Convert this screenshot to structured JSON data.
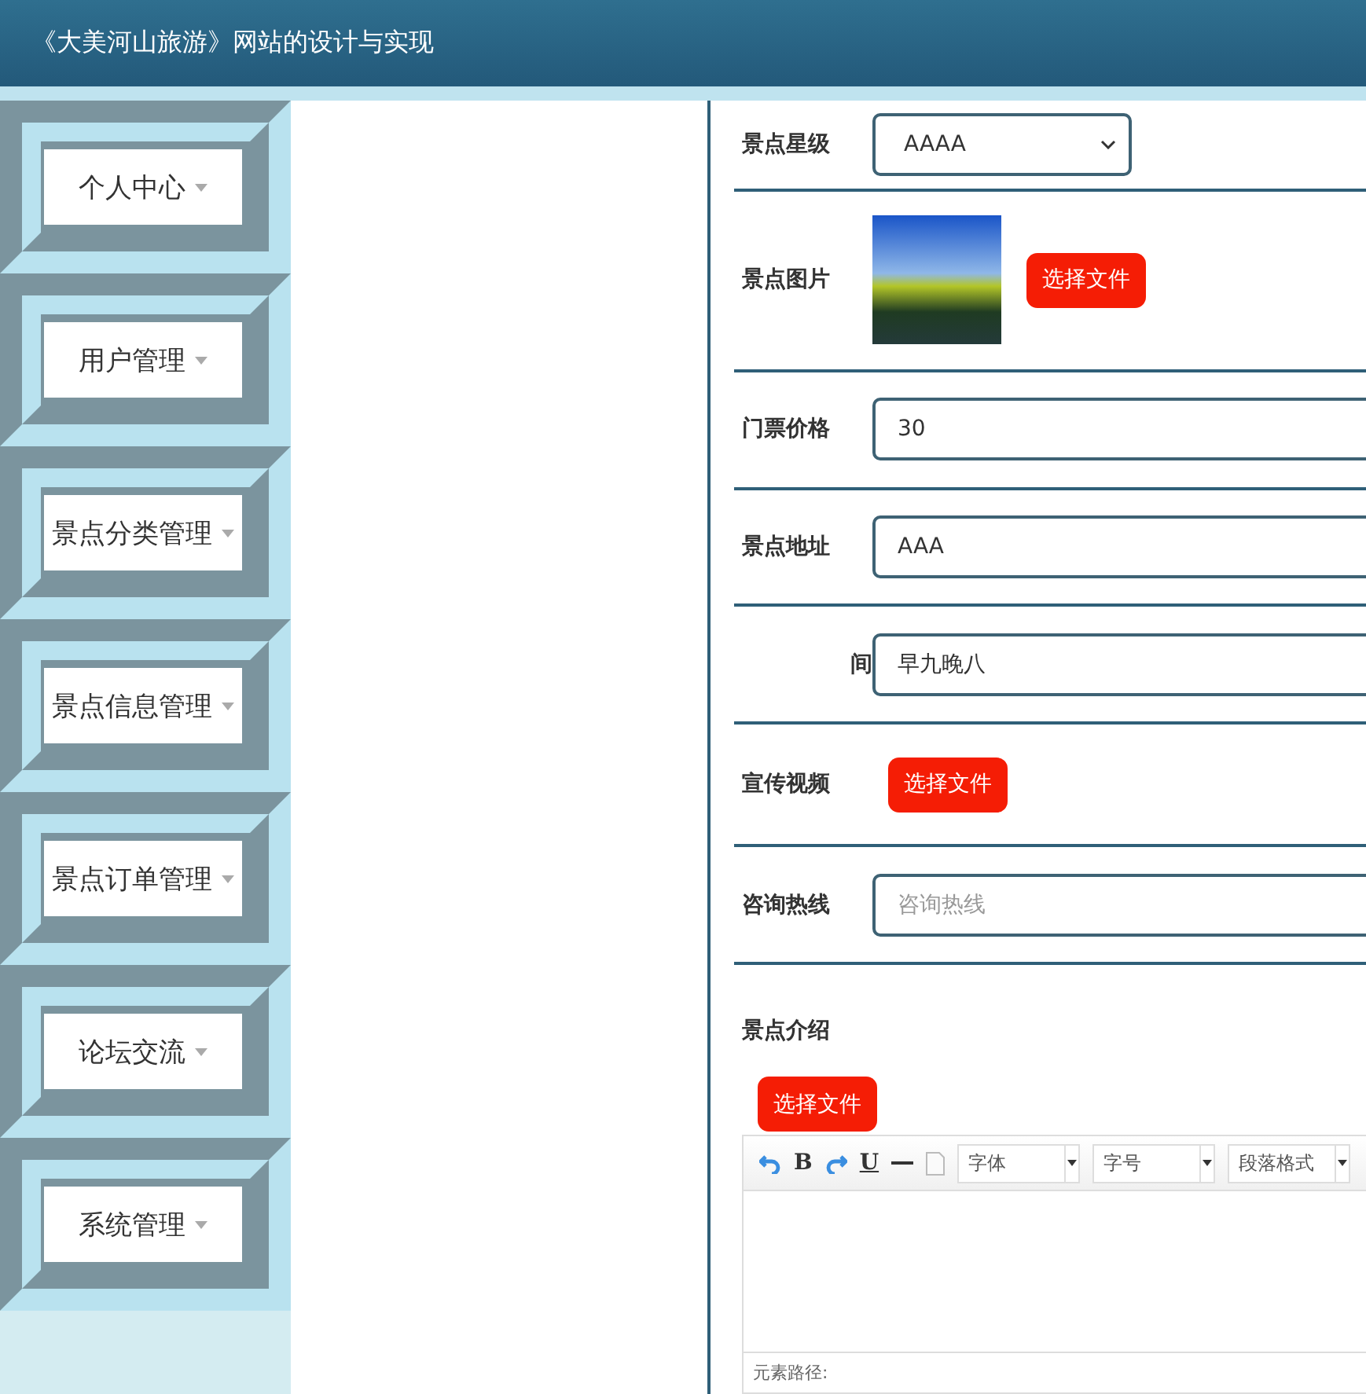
{
  "header": {
    "title": "《大美河山旅游》网站的设计与实现"
  },
  "sidebar": {
    "items": [
      {
        "label": "个人中心"
      },
      {
        "label": "用户管理"
      },
      {
        "label": "景点分类管理"
      },
      {
        "label": "景点信息管理"
      },
      {
        "label": "景点订单管理"
      },
      {
        "label": "论坛交流"
      },
      {
        "label": "系统管理"
      }
    ]
  },
  "form": {
    "fields": [
      {
        "kind": "select",
        "label": "景点星级",
        "value": "AAAA"
      },
      {
        "kind": "image",
        "label": "景点图片",
        "button": "选择文件"
      },
      {
        "kind": "input",
        "label": "门票价格",
        "value": "30"
      },
      {
        "kind": "input",
        "label": "景点地址",
        "value": "AAA"
      },
      {
        "kind": "input",
        "label": "间",
        "value": "早九晚八"
      },
      {
        "kind": "file",
        "label": "宣传视频",
        "button": "选择文件"
      },
      {
        "kind": "input",
        "label": "咨询热线",
        "placeholder": "咨询热线"
      },
      {
        "kind": "editor",
        "label": "景点介绍",
        "button": "选择文件",
        "bold": "B",
        "underline": "U",
        "font": "字体",
        "size": "字号",
        "format": "段落格式",
        "footer": "元素路径:"
      }
    ]
  }
}
